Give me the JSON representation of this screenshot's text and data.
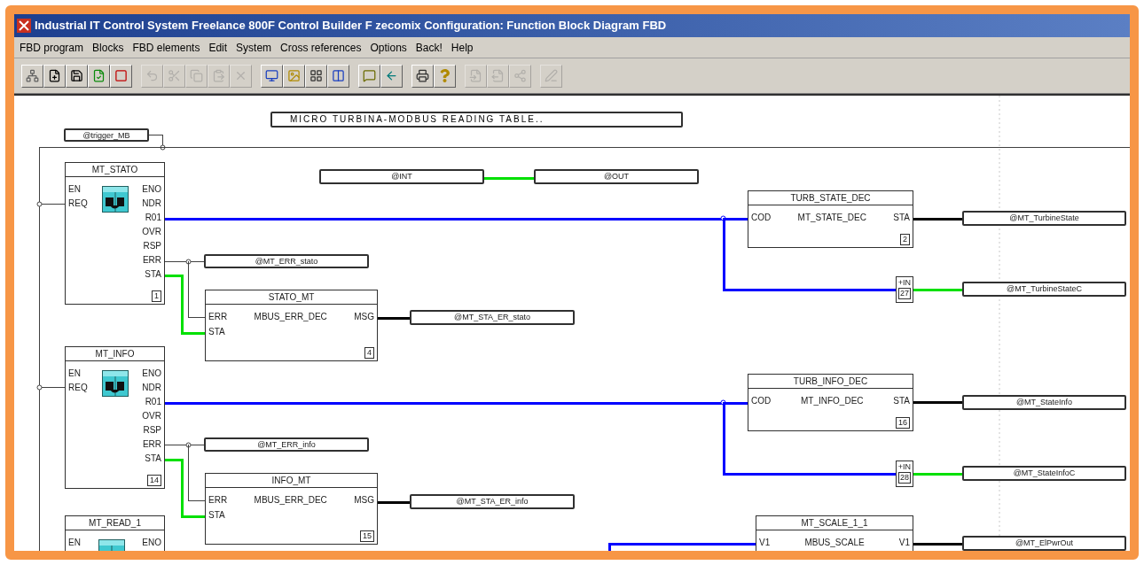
{
  "window": {
    "title": "Industrial IT Control System Freelance 800F Control Builder F zecomix  Configuration: Function Block Diagram FBD"
  },
  "menu": [
    "FBD program",
    "Blocks",
    "FBD elements",
    "Edit",
    "System",
    "Cross references",
    "Options",
    "Back!",
    "Help"
  ],
  "toolbar": [
    {
      "disabled": false
    },
    {
      "disabled": false
    },
    {
      "disabled": false
    },
    {
      "disabled": false
    },
    {
      "disabled": false
    },
    {
      "disabled": true
    },
    {
      "disabled": true
    },
    {
      "disabled": true
    },
    {
      "disabled": true
    },
    {
      "disabled": true
    },
    {
      "disabled": false
    },
    {
      "disabled": false
    },
    {
      "disabled": false
    },
    {
      "disabled": false
    },
    {
      "disabled": false
    },
    {
      "disabled": false
    },
    {
      "disabled": false
    },
    {
      "disabled": false
    },
    {
      "disabled": true
    },
    {
      "disabled": true
    },
    {
      "disabled": true
    },
    {
      "disabled": true
    }
  ],
  "diagram": {
    "comment": "MICRO TURBINA-MODBUS READING TABLE..",
    "variables": [
      "@trigger_MB",
      "@INT",
      "@OUT",
      "@MT_TurbineState",
      "@MT_ERR_stato",
      "@MT_TurbineStateC",
      "@MT_STA_ER_stato",
      "@MT_StateInfo",
      "@MT_ERR_info",
      "@MT_StateInfoC",
      "@MT_STA_ER_info",
      "@MT_ElPwrOut"
    ],
    "blocks": [
      {
        "kind": "modbus",
        "name": "MT_STATO",
        "inputs": [
          "EN",
          "REQ"
        ],
        "outputs": [
          "ENO",
          "NDR",
          "R01",
          "OVR",
          "RSP",
          "ERR",
          "STA"
        ],
        "number": "1"
      },
      {
        "kind": "function",
        "name": "STATO_MT",
        "type": "MBUS_ERR_DEC",
        "inputs": [
          "ERR",
          "STA"
        ],
        "outputs": [
          "MSG"
        ],
        "number": "4"
      },
      {
        "kind": "function",
        "name": "TURB_STATE_DEC",
        "type": "MT_STATE_DEC",
        "inputs": [
          "COD"
        ],
        "outputs": [
          "STA"
        ],
        "number": "2"
      },
      {
        "kind": "mini",
        "name": "+IN",
        "number": "27"
      },
      {
        "kind": "modbus",
        "name": "MT_INFO",
        "inputs": [
          "EN",
          "REQ"
        ],
        "outputs": [
          "ENO",
          "NDR",
          "R01",
          "OVR",
          "RSP",
          "ERR",
          "STA"
        ],
        "number": "14"
      },
      {
        "kind": "function",
        "name": "INFO_MT",
        "type": "MBUS_ERR_DEC",
        "inputs": [
          "ERR",
          "STA"
        ],
        "outputs": [
          "MSG"
        ],
        "number": "15"
      },
      {
        "kind": "function",
        "name": "TURB_INFO_DEC",
        "type": "MT_INFO_DEC",
        "inputs": [
          "COD"
        ],
        "outputs": [
          "STA"
        ],
        "number": "16"
      },
      {
        "kind": "mini",
        "name": "+IN",
        "number": "28"
      },
      {
        "kind": "modbus",
        "name": "MT_READ_1",
        "inputs": [
          "EN"
        ],
        "outputs": [
          "ENO"
        ]
      },
      {
        "kind": "function",
        "name": "MT_SCALE_1_1",
        "type": "MBUS_SCALE",
        "inputs": [
          "V1"
        ],
        "outputs": [
          "V1"
        ]
      }
    ],
    "wires": [
      {
        "color": "#404040"
      },
      {
        "color": "#404040"
      },
      {
        "color": "#404040"
      },
      {
        "color": "#404040"
      },
      {
        "color": "#00e000"
      },
      {
        "color": "#0000ff"
      },
      {
        "color": "#0000ff"
      },
      {
        "color": "#000000"
      },
      {
        "color": "#00e000"
      },
      {
        "color": "#404040"
      },
      {
        "color": "#404040"
      },
      {
        "color": "#00e000"
      },
      {
        "color": "#000000"
      },
      {
        "color": "#0000ff"
      },
      {
        "color": "#0000ff"
      },
      {
        "color": "#000000"
      },
      {
        "color": "#00e000"
      },
      {
        "color": "#404040"
      },
      {
        "color": "#404040"
      },
      {
        "color": "#00e000"
      },
      {
        "color": "#000000"
      },
      {
        "color": "#0000ff"
      },
      {
        "color": "#000000"
      }
    ]
  }
}
